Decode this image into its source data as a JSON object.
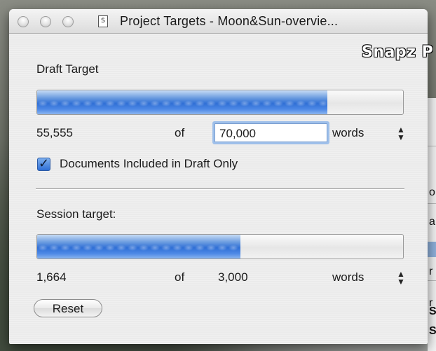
{
  "window": {
    "title": "Project Targets - Moon&Sun-overvie...",
    "doc_icon_glyph": "S"
  },
  "background": {
    "overlay_text": "Snapz P",
    "right_edge_chars": [
      "o",
      "a",
      "r",
      "r",
      "S",
      "S"
    ]
  },
  "draft": {
    "label": "Draft Target",
    "progress": 0.794,
    "current": "55,555",
    "of_label": "of",
    "target_value": "70,000",
    "unit": "words",
    "include_label": "Documents Included in Draft Only",
    "include_checked": true
  },
  "session": {
    "label": "Session target:",
    "progress": 0.555,
    "current": "1,664",
    "of_label": "of",
    "target": "3,000",
    "unit": "words",
    "reset_label": "Reset"
  },
  "colors": {
    "progress_fill": "#2f6fd6",
    "focus_ring": "#9fc0ea"
  }
}
